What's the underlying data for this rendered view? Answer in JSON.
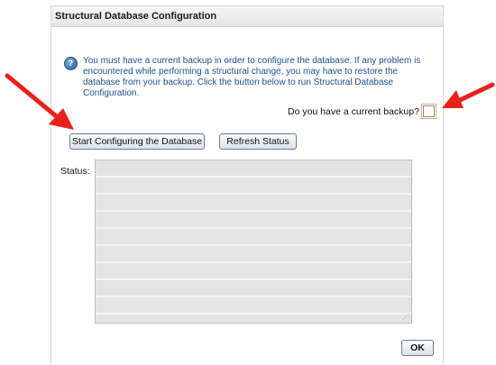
{
  "panel": {
    "title": "Structural Database Configuration"
  },
  "info": {
    "icon": "question-mark-icon",
    "icon_glyph": "?",
    "text": "You must have a current backup in order to configure the database. If any problem is encountered while performing a structural change, you may have to restore the database from your backup. Click the button below to run Structural Database Configuration."
  },
  "backup": {
    "label": "Do you have a current backup?",
    "checked": false
  },
  "buttons": {
    "start_label": "Start Configuring the Database",
    "refresh_label": "Refresh Status",
    "ok_label": "OK"
  },
  "status": {
    "label": "Status:",
    "value": ""
  },
  "colors": {
    "annotation_arrow": "#e8211b",
    "info_text": "#1f4f8f"
  }
}
